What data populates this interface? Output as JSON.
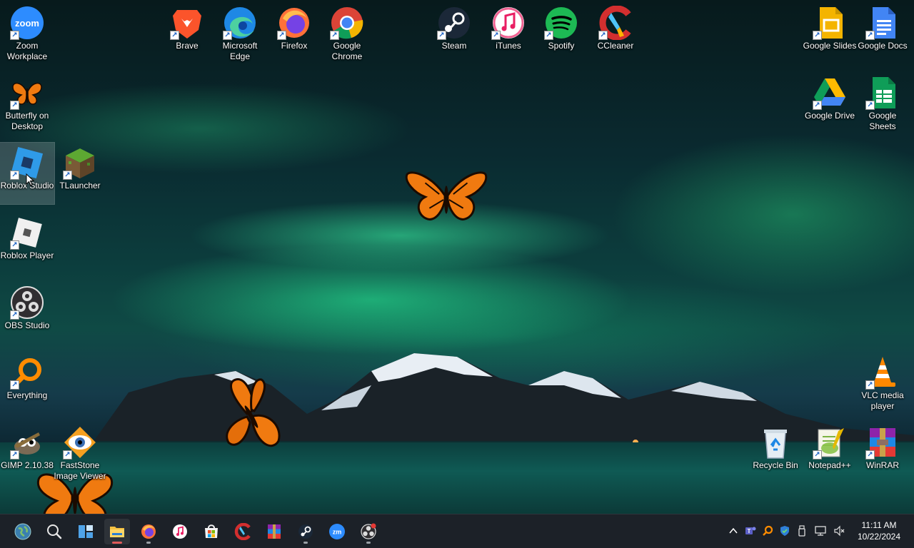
{
  "desktop": {
    "icons": {
      "zoom": "Zoom Workplace",
      "brave": "Brave",
      "edge": "Microsoft Edge",
      "firefox": "Firefox",
      "chrome": "Google Chrome",
      "steam": "Steam",
      "itunes": "iTunes",
      "spotify": "Spotify",
      "ccleaner": "CCleaner",
      "google_slides": "Google Slides",
      "google_docs": "Google Docs",
      "butterfly": "Butterfly on Desktop",
      "google_drive": "Google Drive",
      "google_sheets": "Google Sheets",
      "roblox_studio": "Roblox Studio",
      "tlauncher": "TLauncher",
      "roblox_player": "Roblox Player",
      "obs": "OBS Studio",
      "everything": "Everything",
      "vlc": "VLC media player",
      "gimp": "GIMP 2.10.38",
      "faststone": "FastStone Image Viewer",
      "recycle_bin": "Recycle Bin",
      "notepadpp": "Notepad++",
      "winrar": "WinRAR"
    },
    "selected_icon": "Roblox Studio"
  },
  "taskbar": {
    "time": "11:11 AM",
    "date": "10/22/2024",
    "zoom_label": "zm"
  },
  "colors": {
    "taskbar_bg": "#1c2128",
    "butterfly_orange": "#f07a10",
    "aurora_green": "#3cffaa"
  }
}
